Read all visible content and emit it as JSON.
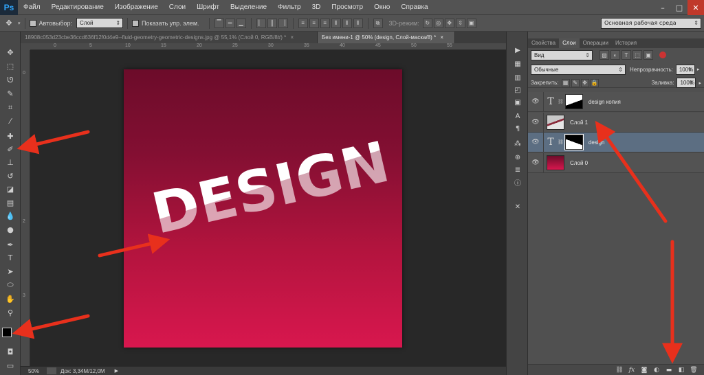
{
  "app": {
    "logo": "Ps"
  },
  "menu": [
    "Файл",
    "Редактирование",
    "Изображение",
    "Слои",
    "Шрифт",
    "Выделение",
    "Фильтр",
    "3D",
    "Просмотр",
    "Окно",
    "Справка"
  ],
  "window_controls": {
    "minimize": "–",
    "maximize": "□",
    "close": "✕"
  },
  "options": {
    "autoselect_label": "Автовыбор:",
    "autoselect_value": "Слой",
    "show_controls_label": "Показать упр. элем.",
    "mode_3d_label": "3D-режим:"
  },
  "workspace_preset": "Основная рабочая среда",
  "doc_tabs": [
    {
      "label": "18908c053d23cbe36ccd636f12f0d4e9--fluid-geometry-geometric-designs.jpg @ 55,1% (Слой 0, RGB/8#) *",
      "close": "×"
    },
    {
      "label": "Без имени-1 @ 50% (design, Слой-маска/8) *",
      "close": "×"
    }
  ],
  "ruler_ticks": [
    "0",
    "5",
    "10",
    "15",
    "20",
    "25",
    "30",
    "35",
    "40",
    "45",
    "50",
    "55"
  ],
  "canvas": {
    "text": "DESIGN"
  },
  "status": {
    "zoom": "50%",
    "doc": "Док: 3,34M/12,0M"
  },
  "panel_tabs": [
    "Свойства",
    "Слои",
    "Операции",
    "История"
  ],
  "layers_panel": {
    "filter_label": "Вид",
    "blend_mode": "Обычные",
    "opacity_label": "Непрозрачность:",
    "opacity_value": "100%",
    "lock_label": "Закрепить:",
    "fill_label": "Заливка:",
    "fill_value": "100%"
  },
  "layers": [
    {
      "name": "design копия",
      "type": "T"
    },
    {
      "name": "Слой 1",
      "type": ""
    },
    {
      "name": "design",
      "type": "T"
    },
    {
      "name": "Слой 0",
      "type": ""
    }
  ],
  "annotation_color": "#e8301c"
}
